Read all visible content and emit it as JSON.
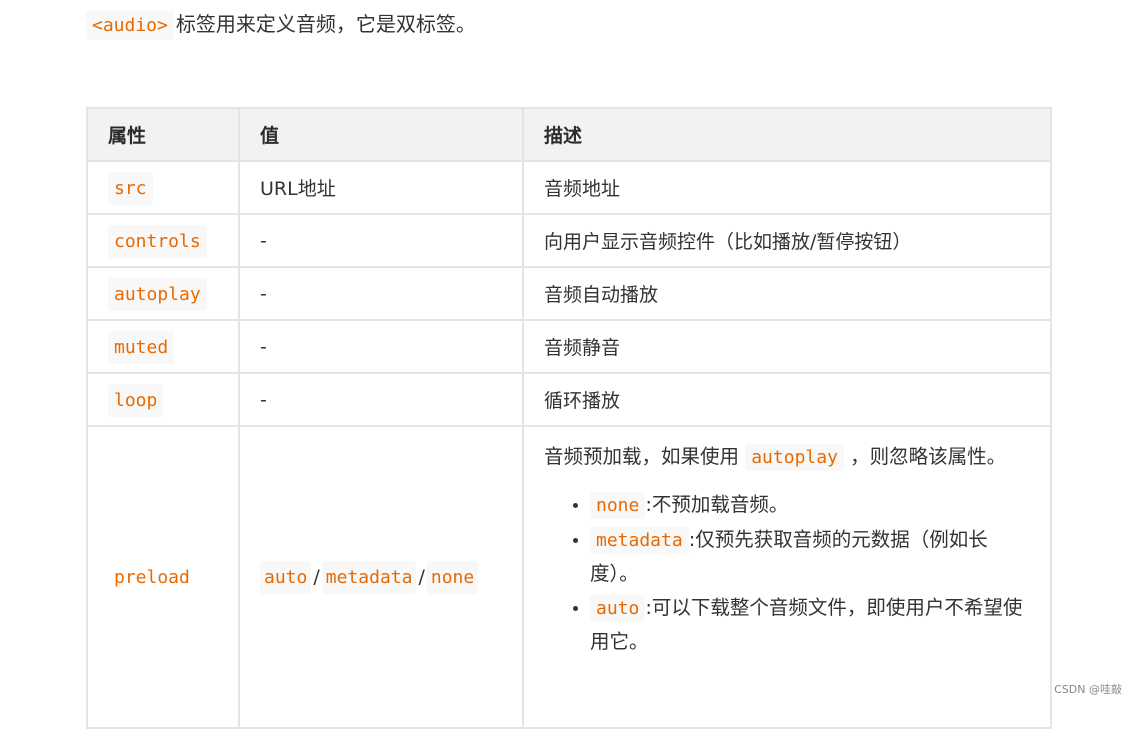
{
  "intro": {
    "tag": "<audio>",
    "text": "标签用来定义音频，它是双标签。"
  },
  "table": {
    "headers": [
      "属性",
      "值",
      "描述"
    ],
    "rows": [
      {
        "name": "src",
        "value": "URL地址",
        "desc": "音频地址"
      },
      {
        "name": "controls",
        "value": "-",
        "desc": "向用户显示音频控件（比如播放/暂停按钮）"
      },
      {
        "name": "autoplay",
        "value": "-",
        "desc": "音频自动播放"
      },
      {
        "name": "muted",
        "value": "-",
        "desc": "音频静音"
      },
      {
        "name": "loop",
        "value": "-",
        "desc": "循环播放"
      }
    ],
    "preload": {
      "name": "preload",
      "values": [
        "auto",
        "metadata",
        "none"
      ],
      "separator": "/",
      "desc_before": "音频预加载，如果使用",
      "desc_code": "autoplay",
      "desc_after": "，则忽略该属性。",
      "items": [
        {
          "code": "none",
          "text": ":不预加载音频。"
        },
        {
          "code": "metadata",
          "text": ":仅预先获取音频的元数据（例如长度）。"
        },
        {
          "code": "auto",
          "text": ":可以下载整个音频文件，即使用户不希望使用它。"
        }
      ]
    }
  },
  "watermark": "CSDN @哇敲"
}
